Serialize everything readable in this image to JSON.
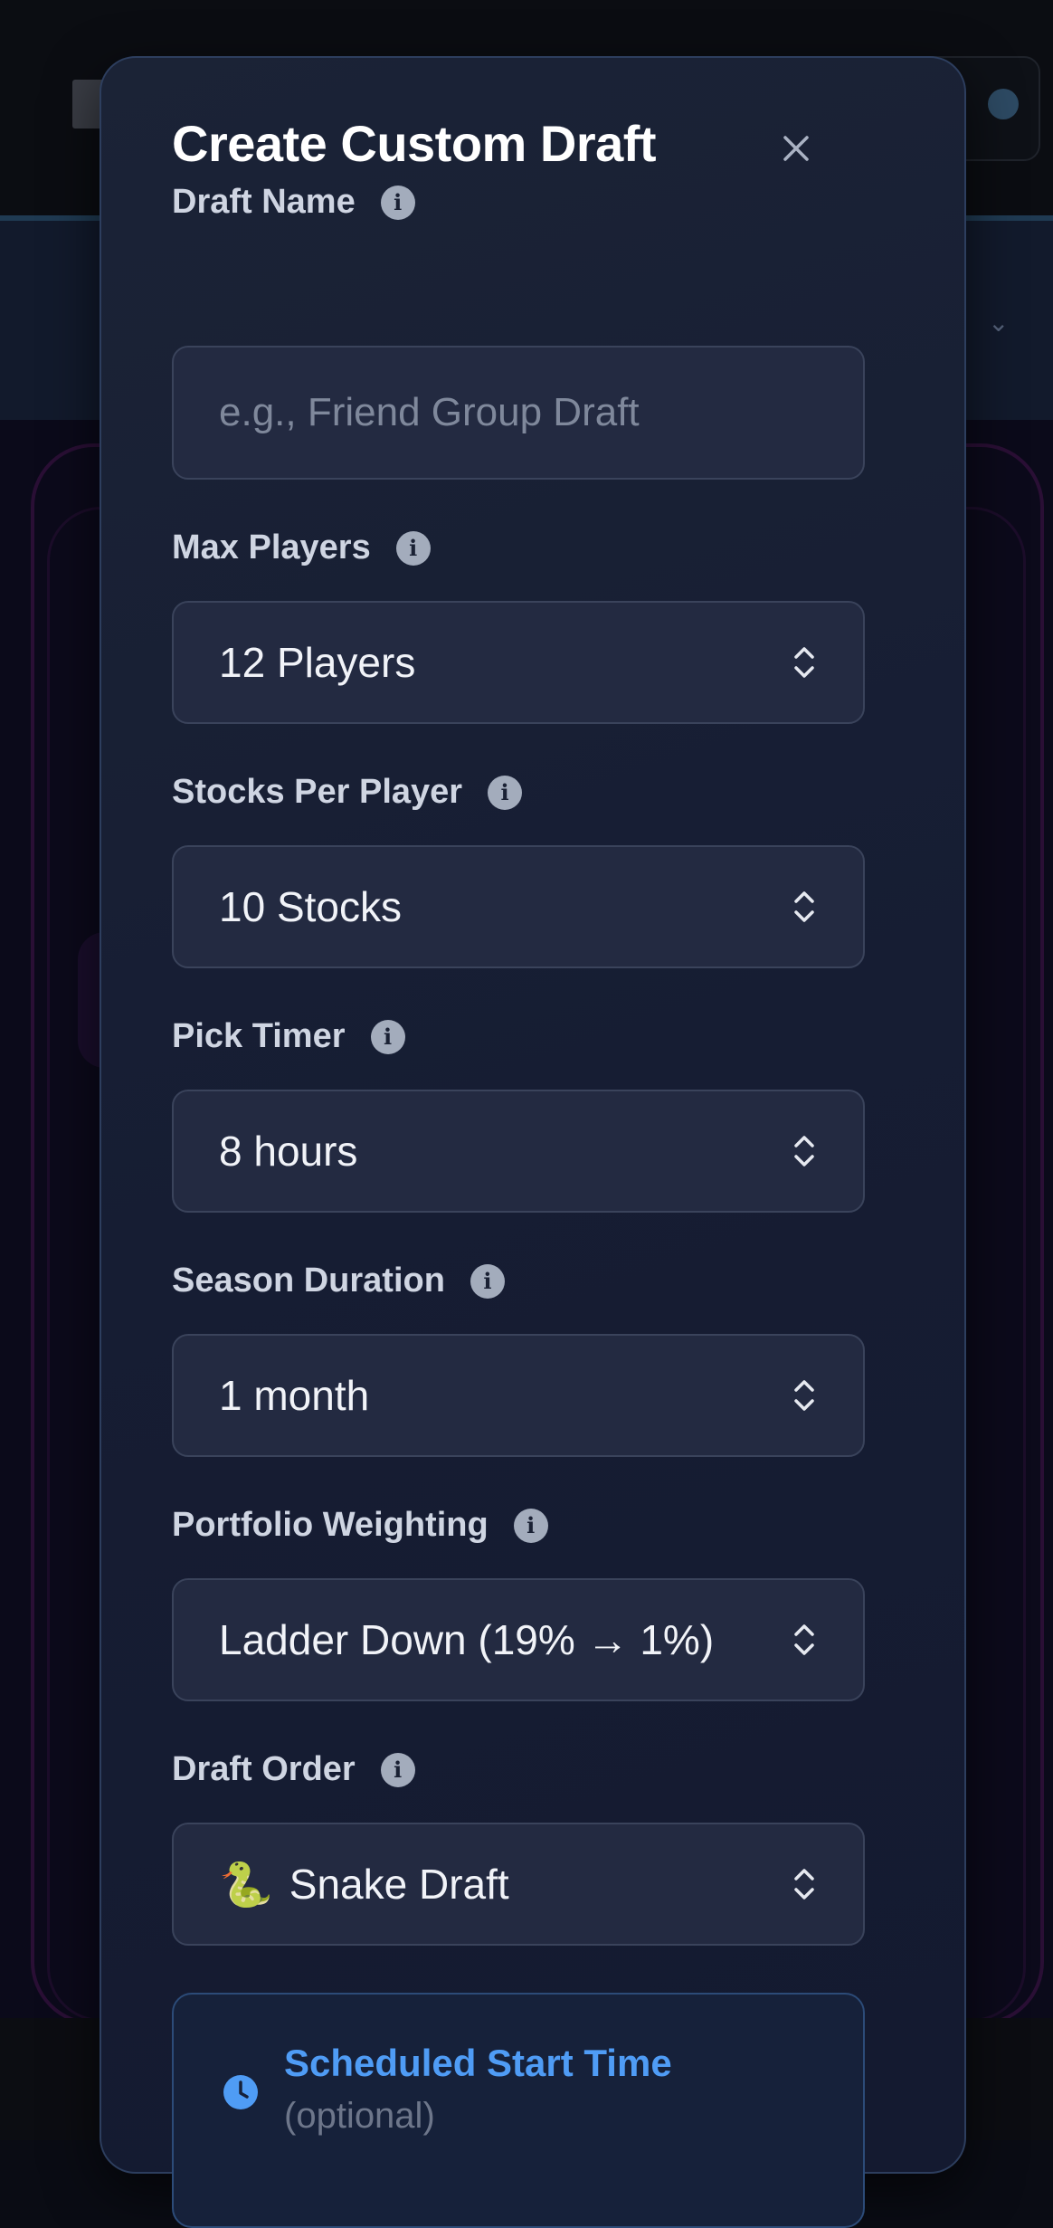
{
  "modal": {
    "title": "Create Custom Draft",
    "close_label": "×"
  },
  "fields": {
    "draft_name": {
      "label": "Draft Name",
      "value": "",
      "placeholder": "e.g., Friend Group Draft"
    },
    "max_players": {
      "label": "Max Players",
      "value": "12 Players"
    },
    "stocks_per_player": {
      "label": "Stocks Per Player",
      "value": "10 Stocks"
    },
    "pick_timer": {
      "label": "Pick Timer",
      "value": "8 hours"
    },
    "season_duration": {
      "label": "Season Duration",
      "value": "1 month"
    },
    "portfolio_weighting": {
      "label": "Portfolio Weighting",
      "value": "Ladder Down (19% → 1%)"
    },
    "draft_order": {
      "label": "Draft Order",
      "emoji": "🐍",
      "value": "Snake Draft"
    }
  },
  "schedule": {
    "title": "Scheduled Start Time",
    "subtitle": "(optional)"
  },
  "icons": {
    "info": "info-icon",
    "close": "close-icon",
    "clock": "clock-icon",
    "select_arrows": "chevron-up-down-icon"
  },
  "colors": {
    "accent_blue": "#4f9cf5",
    "modal_bg": "#1b2336",
    "input_bg": "#232a41"
  }
}
